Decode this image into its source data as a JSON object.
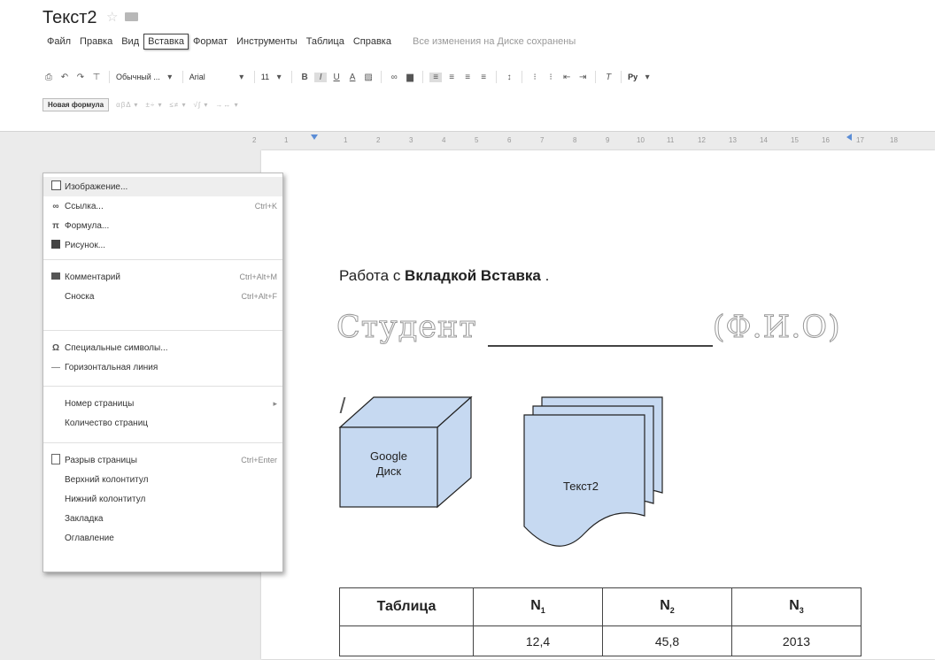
{
  "title": "Текст2",
  "menubar": {
    "items": [
      "Файл",
      "Правка",
      "Вид",
      "Вставка",
      "Формат",
      "Инструменты",
      "Таблица",
      "Справка"
    ],
    "active": "Вставка",
    "saved_status": "Все изменения на Диске сохранены"
  },
  "toolbar": {
    "style": "Обычный ...",
    "font": "Arial",
    "size": "11",
    "lang": "Ру"
  },
  "equation_bar": {
    "new_formula_label": "Новая формула"
  },
  "ruler": {
    "ticks": [
      "2",
      "1",
      "1",
      "2",
      "3",
      "4",
      "5",
      "6",
      "7",
      "8",
      "9",
      "10",
      "11",
      "12",
      "13",
      "14",
      "15",
      "16",
      "17",
      "18"
    ]
  },
  "insert_menu": {
    "items": [
      {
        "label": "Изображение...",
        "shortcut": "",
        "icon": "image-icon"
      },
      {
        "label": "Ссылка...",
        "shortcut": "Ctrl+K",
        "icon": "link-icon"
      },
      {
        "label": "Формула...",
        "shortcut": "",
        "icon": "pi-icon"
      },
      {
        "label": "Рисунок...",
        "shortcut": "",
        "icon": "drawing-icon"
      },
      {
        "label": "Комментарий",
        "shortcut": "Ctrl+Alt+M",
        "icon": "comment-icon"
      },
      {
        "label": "Сноска",
        "shortcut": "Ctrl+Alt+F",
        "icon": ""
      },
      {
        "label": "Специальные символы...",
        "shortcut": "",
        "icon": "omega-icon"
      },
      {
        "label": "Горизонтальная линия",
        "shortcut": "",
        "icon": "hr-icon"
      },
      {
        "label": "Номер страницы",
        "shortcut": "▸",
        "icon": ""
      },
      {
        "label": "Количество страниц",
        "shortcut": "",
        "icon": ""
      },
      {
        "label": "Разрыв страницы",
        "shortcut": "Ctrl+Enter",
        "icon": "page-break-icon"
      },
      {
        "label": "Верхний колонтитул",
        "shortcut": "",
        "icon": ""
      },
      {
        "label": "Нижний колонтитул",
        "shortcut": "",
        "icon": ""
      },
      {
        "label": "Закладка",
        "shortcut": "",
        "icon": ""
      },
      {
        "label": "Оглавление",
        "shortcut": "",
        "icon": ""
      }
    ]
  },
  "document": {
    "heading_prefix": "Работа с ",
    "heading_bold": "Вкладкой Вставка",
    "heading_suffix": " .",
    "student_label": "Студент",
    "student_suffix": "(Ф.И.О)",
    "cube_line1": "Google",
    "cube_line2": "Диск",
    "sheet_label": "Текст2",
    "table": {
      "header": [
        "Таблица",
        "N",
        "N",
        "N"
      ],
      "subscripts": [
        "1",
        "2",
        "3"
      ],
      "row": [
        "",
        "12,4",
        "45,8",
        "2013"
      ]
    },
    "colors": {
      "shape_fill": "#c6d9f1",
      "shape_stroke": "#222222"
    }
  }
}
